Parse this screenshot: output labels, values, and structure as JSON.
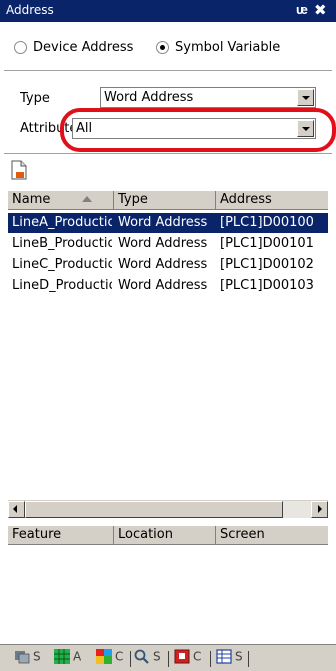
{
  "window": {
    "title": "Address",
    "pin_icon": "pin-icon",
    "close_icon": "close-icon",
    "colors": {
      "titlebar": "#0a246a",
      "selection": "#0a246a",
      "highlight": "#e0101a"
    }
  },
  "mode": {
    "options": [
      {
        "label": "Device Address",
        "checked": false
      },
      {
        "label": "Symbol Variable",
        "checked": true
      }
    ]
  },
  "filters": {
    "type_label": "Type",
    "type_value": "Word Address",
    "attribute_label": "Attribute",
    "attribute_value": "All"
  },
  "toolbar": {
    "new_icon": "new-document-icon"
  },
  "table": {
    "columns": [
      "Name",
      "Type",
      "Address"
    ],
    "rows": [
      {
        "name": "LineA_Productio",
        "type": "Word Address",
        "address": "[PLC1]D00100"
      },
      {
        "name": "LineB_Productio",
        "type": "Word Address",
        "address": "[PLC1]D00101"
      },
      {
        "name": "LineC_Productio",
        "type": "Word Address",
        "address": "[PLC1]D00102"
      },
      {
        "name": "LineD_Productio",
        "type": "Word Address",
        "address": "[PLC1]D00103"
      }
    ]
  },
  "feature_table": {
    "columns": [
      "Feature",
      "Location",
      "Screen"
    ]
  },
  "tabs": [
    {
      "icon": "screen-list-icon",
      "label": "S"
    },
    {
      "icon": "address-grid-icon",
      "label": "A"
    },
    {
      "icon": "color-palette-icon",
      "label": "C"
    },
    {
      "icon": "search-icon",
      "label": "S"
    },
    {
      "icon": "common-settings-icon",
      "label": "C"
    },
    {
      "icon": "system-variable-icon",
      "label": "S"
    }
  ]
}
